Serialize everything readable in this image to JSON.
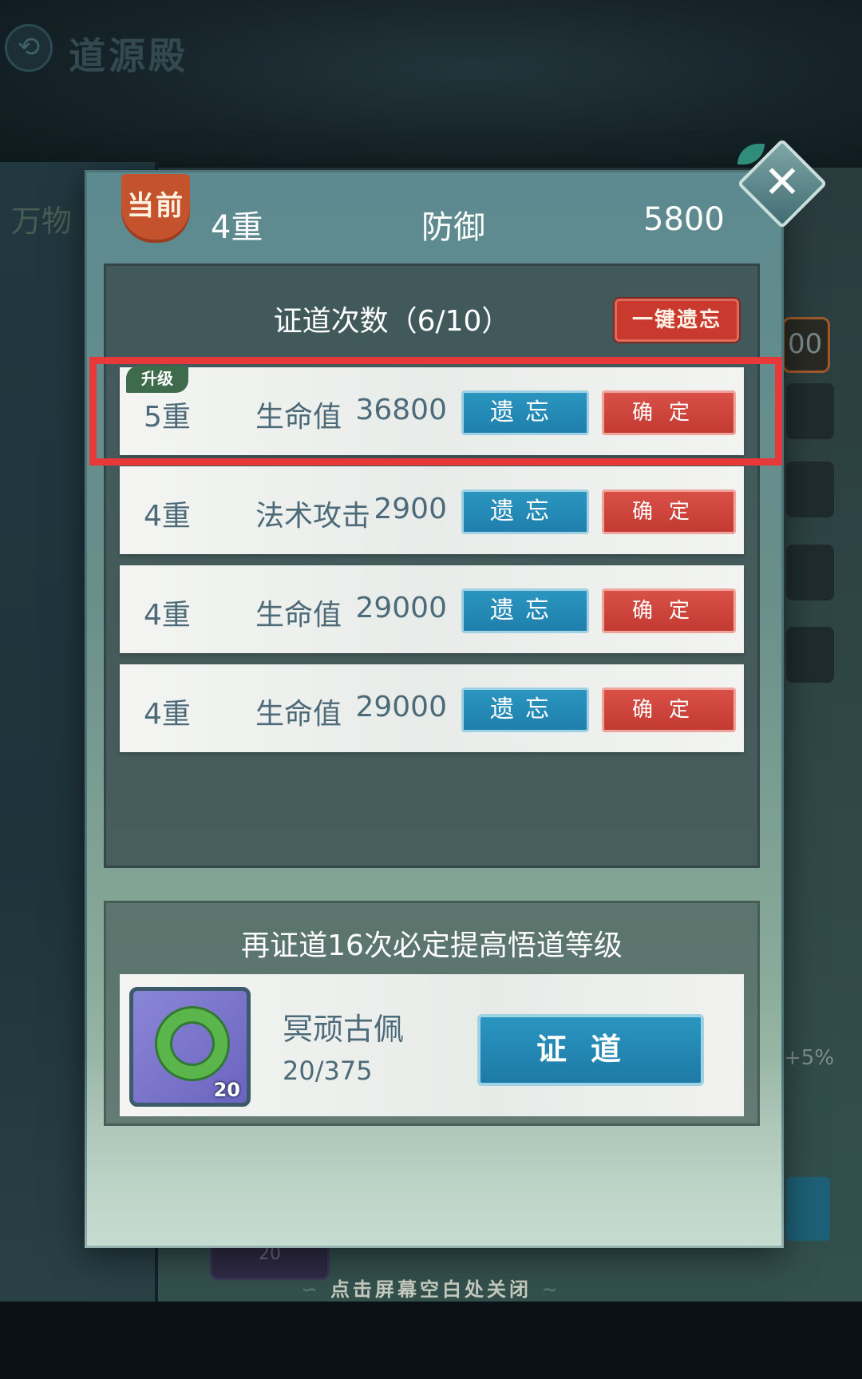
{
  "screen": {
    "title": "道源殿",
    "left_tab_label": "万物",
    "right_partial_value": "00",
    "right_partial_percent": "+5%",
    "right_partial_item_count": "20",
    "close_hint": "点击屏幕空白处关闭"
  },
  "dialog": {
    "current_badge": "当前",
    "current": {
      "level": "4重",
      "attribute": "防御",
      "value": "5800"
    },
    "attempts_title": "证道次数（6/10）",
    "forget_all_label": "一键遗忘",
    "rows": [
      {
        "level": "5重",
        "attribute": "生命值",
        "value": "36800",
        "badge": "升级",
        "forget_label": "遗忘",
        "confirm_label": "确定"
      },
      {
        "level": "4重",
        "attribute": "法术攻击",
        "value": "2900",
        "forget_label": "遗忘",
        "confirm_label": "确定"
      },
      {
        "level": "4重",
        "attribute": "生命值",
        "value": "29000",
        "forget_label": "遗忘",
        "confirm_label": "确定"
      },
      {
        "level": "4重",
        "attribute": "生命值",
        "value": "29000",
        "forget_label": "遗忘",
        "confirm_label": "确定"
      }
    ],
    "guarantee_hint": "再证道16次必定提高悟道等级",
    "item": {
      "name": "冥顽古佩",
      "progress": "20/375",
      "count": "20",
      "icon": "jade-pendant-icon"
    },
    "prove_label": "证道"
  },
  "colors": {
    "highlight": "#e8393a",
    "forget_button": "#2a95c0",
    "confirm_button": "#d85046",
    "badge_current": "#c4522c"
  }
}
